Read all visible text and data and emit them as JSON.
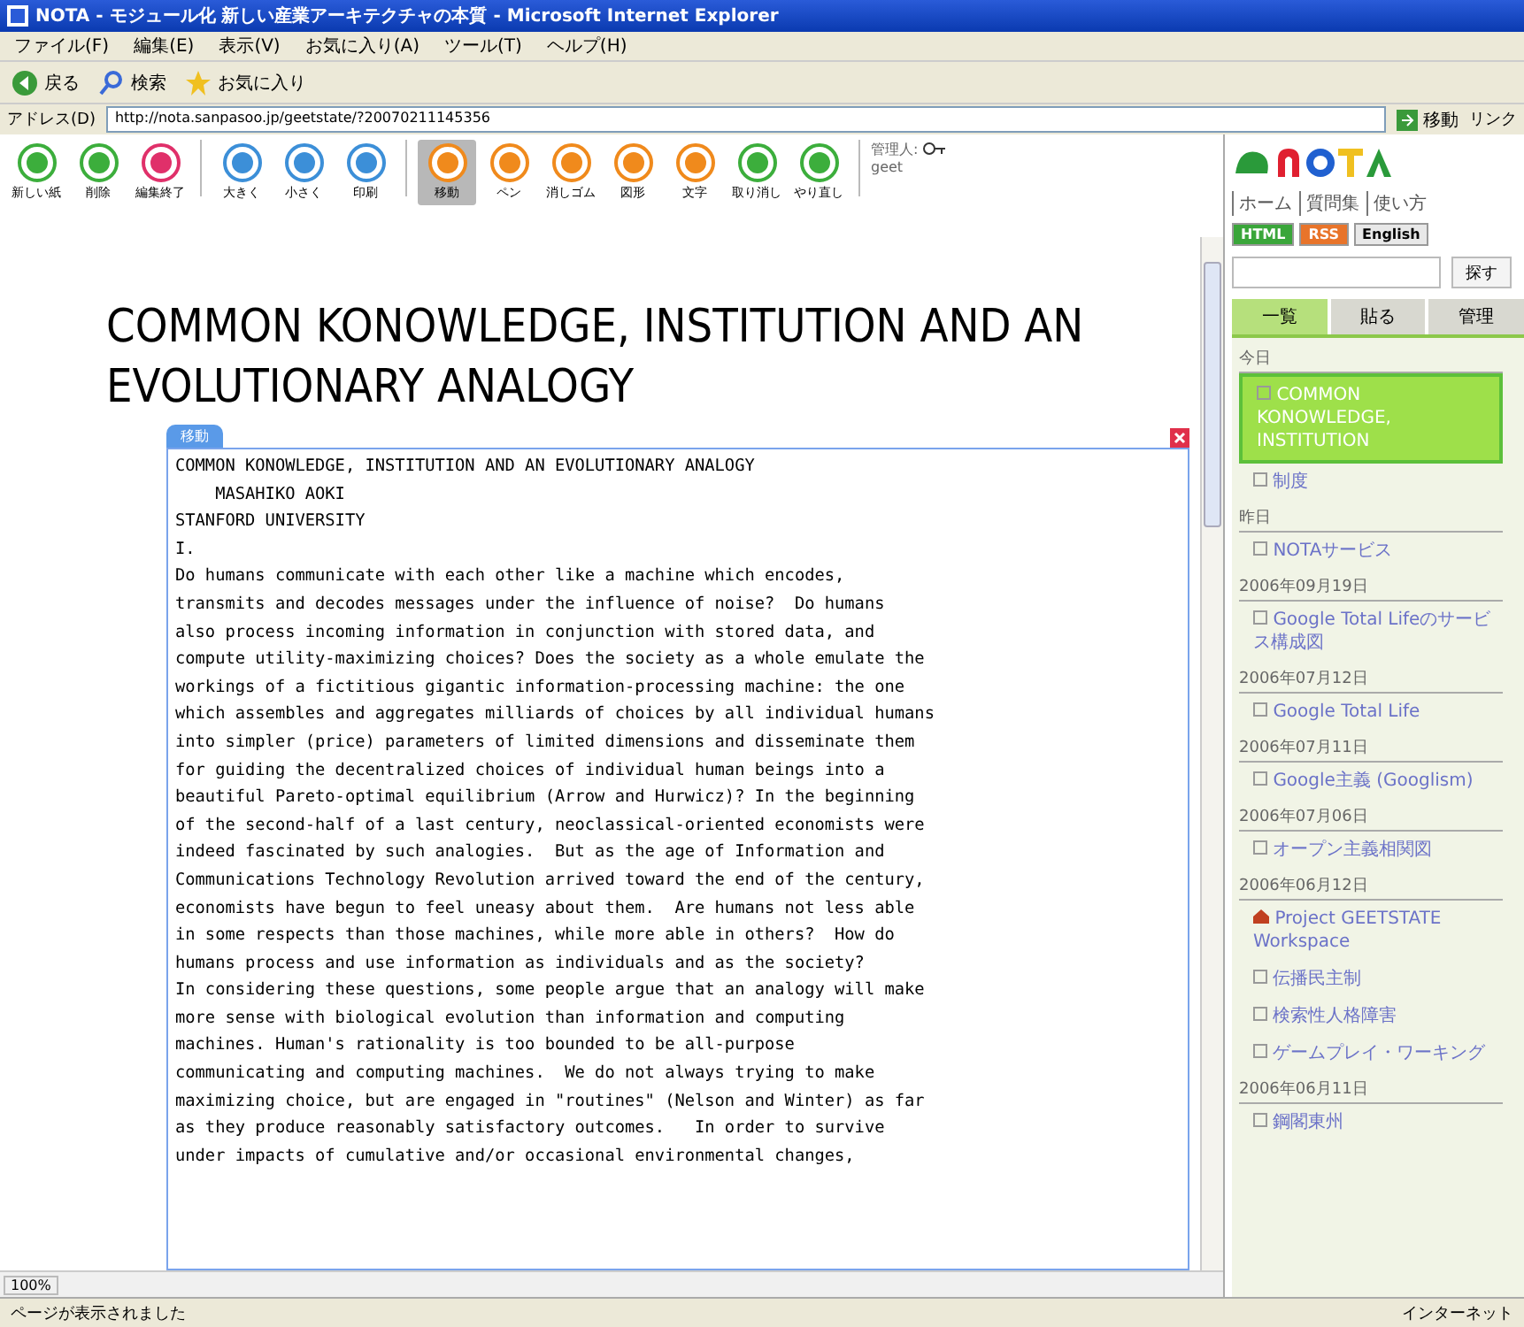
{
  "window": {
    "title": "NOTA - モジュール化 新しい産業アーキテクチャの本質 - Microsoft Internet Explorer"
  },
  "menu": [
    "ファイル(F)",
    "編集(E)",
    "表示(V)",
    "お気に入り(A)",
    "ツール(T)",
    "ヘルプ(H)"
  ],
  "nav_toolbar": {
    "back": "戻る",
    "search": "検索",
    "favorites": "お気に入り"
  },
  "address_bar": {
    "label": "アドレス(D)",
    "value": "http://nota.sanpasoo.jp/geetstate/?20070211145356",
    "go": "移動",
    "links": "リンク"
  },
  "app_toolbar": [
    {
      "label": "新しい紙",
      "color": "#3cae3c",
      "selected": false
    },
    {
      "label": "削除",
      "color": "#3cae3c",
      "selected": false
    },
    {
      "label": "編集終了",
      "color": "#e0306a",
      "selected": false
    },
    {
      "label": "大きく",
      "color": "#3c8fd8",
      "selected": false
    },
    {
      "label": "小さく",
      "color": "#3c8fd8",
      "selected": false
    },
    {
      "label": "印刷",
      "color": "#3c8fd8",
      "selected": false
    },
    {
      "label": "移動",
      "color": "#f08a1c",
      "selected": true
    },
    {
      "label": "ペン",
      "color": "#f08a1c",
      "selected": false
    },
    {
      "label": "消しゴム",
      "color": "#f08a1c",
      "selected": false
    },
    {
      "label": "図形",
      "color": "#f08a1c",
      "selected": false
    },
    {
      "label": "文字",
      "color": "#f08a1c",
      "selected": false
    },
    {
      "label": "取り消し",
      "color": "#3cae3c",
      "selected": false
    },
    {
      "label": "やり直し",
      "color": "#3cae3c",
      "selected": false
    }
  ],
  "admin": {
    "label": "管理人:",
    "user": "geet"
  },
  "page": {
    "heading": "COMMON KONOWLEDGE, INSTITUTION AND AN EVOLUTIONARY ANALOGY",
    "note": {
      "tab": "移動",
      "lines": [
        "COMMON KONOWLEDGE, INSTITUTION AND AN EVOLUTIONARY ANALOGY",
        "    MASAHIKO AOKI",
        "STANFORD UNIVERSITY",
        "I.",
        "Do humans communicate with each other like a machine which encodes,",
        "transmits and decodes messages under the influence of noise?  Do humans",
        "also process incoming information in conjunction with stored data, and",
        "compute utility-maximizing choices? Does the society as a whole emulate the",
        "workings of a fictitious gigantic information-processing machine: the one",
        "which assembles and aggregates milliards of choices by all individual humans",
        "into simpler (price) parameters of limited dimensions and disseminate them",
        "for guiding the decentralized choices of individual human beings into a",
        "beautiful Pareto-optimal equilibrium (Arrow and Hurwicz)? In the beginning",
        "of the second-half of a last century, neoclassical-oriented economists were",
        "indeed fascinated by such analogies.  But as the age of Information and",
        "Communications Technology Revolution arrived toward the end of the century,",
        "economists have begun to feel uneasy about them.  Are humans not less able",
        "in some respects than those machines, while more able in others?  How do",
        "humans process and use information as individuals and as the society?",
        "In considering these questions, some people argue that an analogy will make",
        "more sense with biological evolution than information and computing",
        "machines. Human's rationality is too bounded to be all-purpose",
        "communicating and computing machines.  We do not always trying to make",
        "maximizing choice, but are engaged in \"routines\" (Nelson and Winter) as far",
        "as they produce reasonably satisfactory outcomes.   In order to survive",
        "under impacts of cumulative and/or occasional environmental changes,"
      ]
    },
    "zoom": "100%"
  },
  "sidebar": {
    "links": [
      "ホーム",
      "質問集",
      "使い方"
    ],
    "badges": [
      {
        "label": "HTML",
        "color": "#3aa63a"
      },
      {
        "label": "RSS",
        "color": "#e8742a"
      },
      {
        "label": "English",
        "color": "#e8e8e8"
      }
    ],
    "search_button": "探す",
    "tabs": [
      {
        "label": "一覧",
        "selected": true
      },
      {
        "label": "貼る",
        "selected": false
      },
      {
        "label": "管理",
        "selected": false
      }
    ],
    "items": [
      {
        "kind": "date",
        "label": "今日"
      },
      {
        "kind": "page",
        "label": "COMMON KONOWLEDGE, INSTITUTION",
        "selected": true
      },
      {
        "kind": "page",
        "label": "制度",
        "selected": false
      },
      {
        "kind": "date",
        "label": "昨日"
      },
      {
        "kind": "page",
        "label": "NOTAサービス",
        "selected": false
      },
      {
        "kind": "date",
        "label": "2006年09月19日"
      },
      {
        "kind": "page",
        "label": "Google Total Lifeのサービス構成図",
        "selected": false
      },
      {
        "kind": "date",
        "label": "2006年07月12日"
      },
      {
        "kind": "page",
        "label": "Google Total Life",
        "selected": false
      },
      {
        "kind": "date",
        "label": "2006年07月11日"
      },
      {
        "kind": "page",
        "label": "Google主義 (Googlism)",
        "selected": false
      },
      {
        "kind": "date",
        "label": "2006年07月06日"
      },
      {
        "kind": "page",
        "label": "オープン主義相関図",
        "selected": false
      },
      {
        "kind": "date",
        "label": "2006年06月12日"
      },
      {
        "kind": "project",
        "label": "Project GEETSTATE Workspace",
        "selected": false
      },
      {
        "kind": "page",
        "label": "伝播民主制",
        "selected": false
      },
      {
        "kind": "page",
        "label": "検索性人格障害",
        "selected": false
      },
      {
        "kind": "page",
        "label": "ゲームプレイ・ワーキング",
        "selected": false
      },
      {
        "kind": "date",
        "label": "2006年06月11日"
      },
      {
        "kind": "page",
        "label": "鋼閣東州",
        "selected": false
      }
    ]
  },
  "status_bar": {
    "text": "ページが表示されました",
    "zone": "インターネット"
  }
}
